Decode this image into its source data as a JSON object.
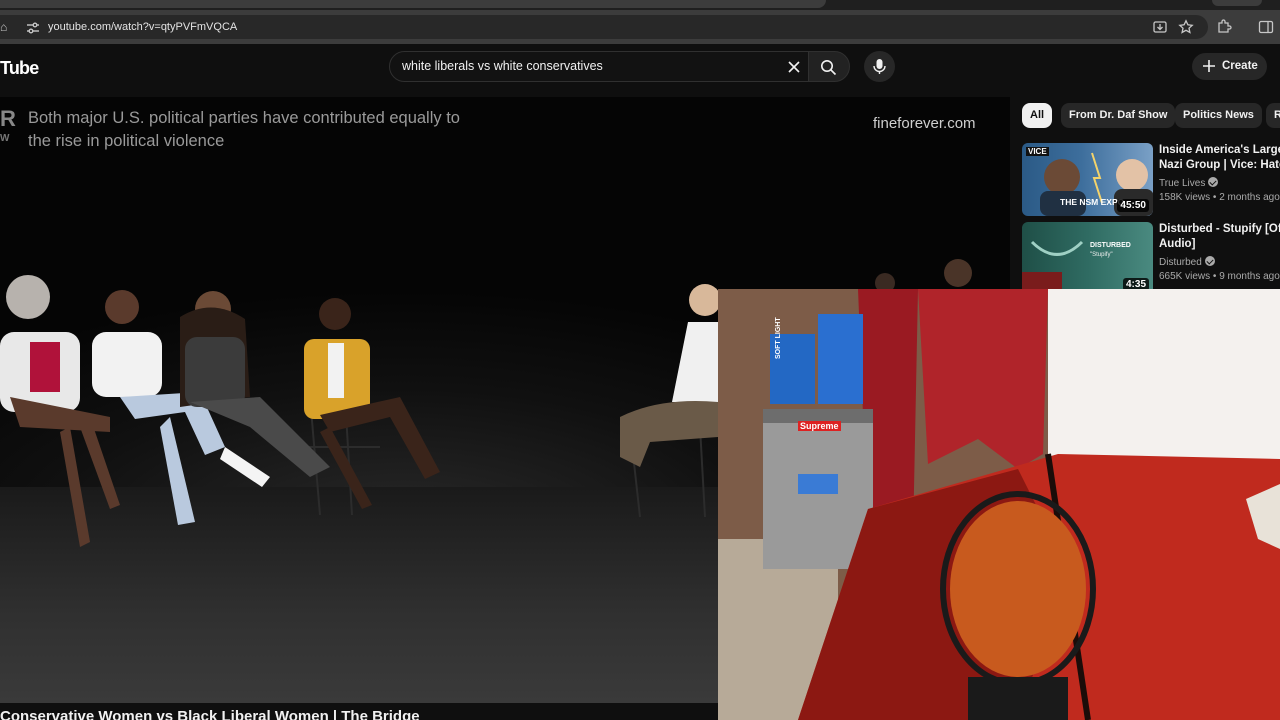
{
  "browser": {
    "url": "youtube.com/watch?v=qtyPVFmVQCA",
    "icons": [
      "home-icon",
      "site-settings-icon",
      "install-icon",
      "bookmark-star-icon",
      "extensions-icon",
      "side-panel-icon"
    ]
  },
  "masthead": {
    "logo_text": "Tube",
    "search_value": "white liberals vs white conservatives",
    "create_label": "Create"
  },
  "video": {
    "overlay_text": "Both major U.S. political parties have contributed equally to the rise in political violence",
    "overlay_site": "fineforever.com",
    "title": "Conservative Women vs Black Liberal Women | The Bridge"
  },
  "chips": [
    {
      "label": "All",
      "active": true
    },
    {
      "label": "From Dr. Daf Show",
      "active": false
    },
    {
      "label": "Politics News",
      "active": false
    },
    {
      "label": "R",
      "active": false
    }
  ],
  "recommendations": [
    {
      "title_line1": "Inside America's Largest",
      "title_line2": "Nazi Group | Vice: Hate T",
      "channel": "True Lives",
      "meta": "158K views • 2 months ago",
      "duration": "45:50",
      "thumb_text": "THE NSM EXPO",
      "thumb_badge": "VICE"
    },
    {
      "title_line1": "Disturbed - Stupify [Offici",
      "title_line2": "Audio]",
      "channel": "Disturbed",
      "meta": "665K views • 9 months ago",
      "duration": "4:35",
      "thumb_text": "DISTURBED",
      "thumb_sub": "\"Stupify\""
    }
  ],
  "webcam": {
    "box_label": "SOFT LIGHT",
    "fridge_brand": "Supreme"
  }
}
